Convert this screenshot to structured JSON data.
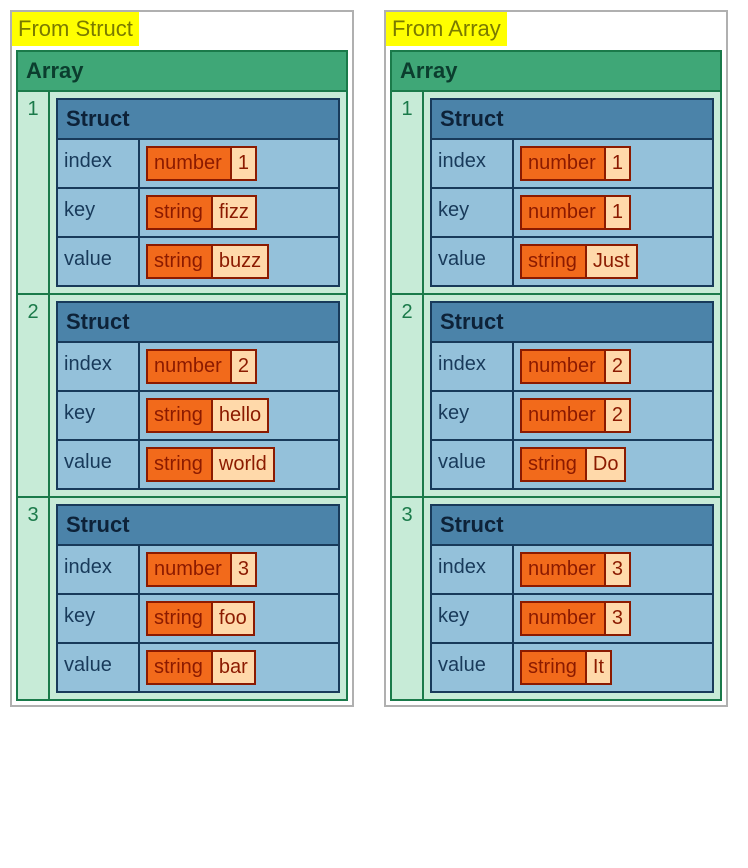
{
  "labels": {
    "array": "Array",
    "struct": "Struct",
    "number": "number",
    "string": "string",
    "index": "index",
    "key": "key",
    "value": "value"
  },
  "panels": [
    {
      "title": "From Struct",
      "items": [
        {
          "idx": "1",
          "index": {
            "type": "number",
            "value": "1"
          },
          "key": {
            "type": "string",
            "value": "fizz"
          },
          "value": {
            "type": "string",
            "value": "buzz"
          }
        },
        {
          "idx": "2",
          "index": {
            "type": "number",
            "value": "2"
          },
          "key": {
            "type": "string",
            "value": "hello"
          },
          "value": {
            "type": "string",
            "value": "world"
          }
        },
        {
          "idx": "3",
          "index": {
            "type": "number",
            "value": "3"
          },
          "key": {
            "type": "string",
            "value": "foo"
          },
          "value": {
            "type": "string",
            "value": "bar"
          }
        }
      ]
    },
    {
      "title": "From Array",
      "items": [
        {
          "idx": "1",
          "index": {
            "type": "number",
            "value": "1"
          },
          "key": {
            "type": "number",
            "value": "1"
          },
          "value": {
            "type": "string",
            "value": "Just"
          }
        },
        {
          "idx": "2",
          "index": {
            "type": "number",
            "value": "2"
          },
          "key": {
            "type": "number",
            "value": "2"
          },
          "value": {
            "type": "string",
            "value": "Do"
          }
        },
        {
          "idx": "3",
          "index": {
            "type": "number",
            "value": "3"
          },
          "key": {
            "type": "number",
            "value": "3"
          },
          "value": {
            "type": "string",
            "value": "It"
          }
        }
      ]
    }
  ]
}
